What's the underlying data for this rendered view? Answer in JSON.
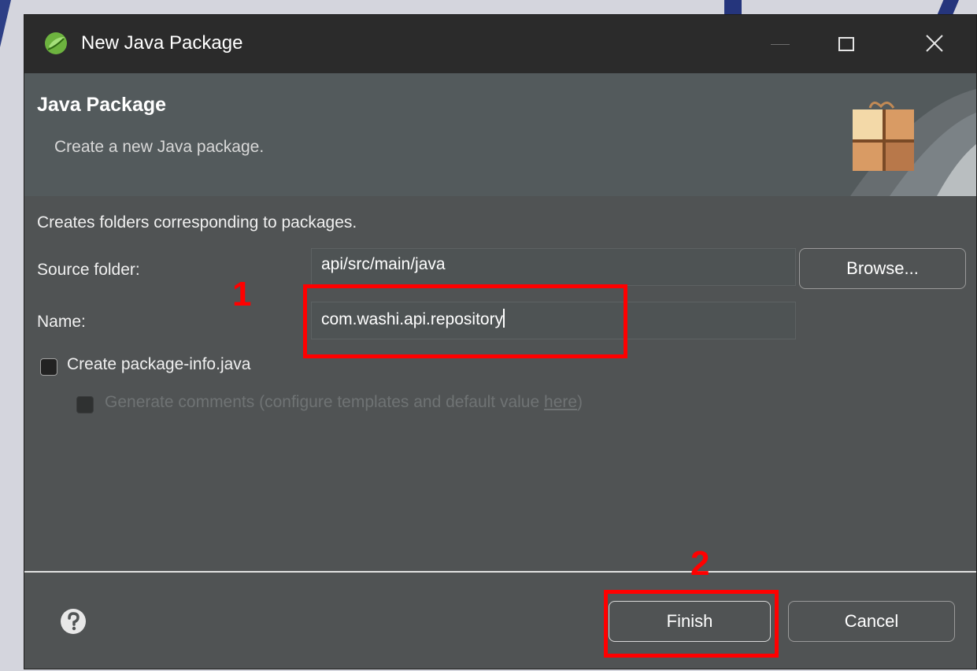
{
  "window": {
    "title": "New Java Package",
    "icon": "eclipse-spring-icon"
  },
  "header": {
    "title": "Java Package",
    "description": "Create a new Java package.",
    "icon": "package-icon"
  },
  "content": {
    "description": "Creates folders corresponding to packages.",
    "source_folder": {
      "label": "Source folder:",
      "value": "api/src/main/java"
    },
    "browse_button": "Browse...",
    "name": {
      "label": "Name:",
      "value": "com.washi.api.repository"
    },
    "create_package_info": {
      "label": "Create package-info.java",
      "checked": false
    },
    "generate_comments": {
      "label": "Generate comments",
      "suffix": "(configure templates and default value ",
      "link": "here",
      "end": ")",
      "enabled": false
    }
  },
  "footer": {
    "finish_label": "Finish",
    "cancel_label": "Cancel"
  },
  "annotations": {
    "step1": "1",
    "step2": "2",
    "color": "#ff0000"
  },
  "colors": {
    "titlebar": "#2b2b2b",
    "dialog_bg": "#505354",
    "header_bg": "#535a5c"
  }
}
